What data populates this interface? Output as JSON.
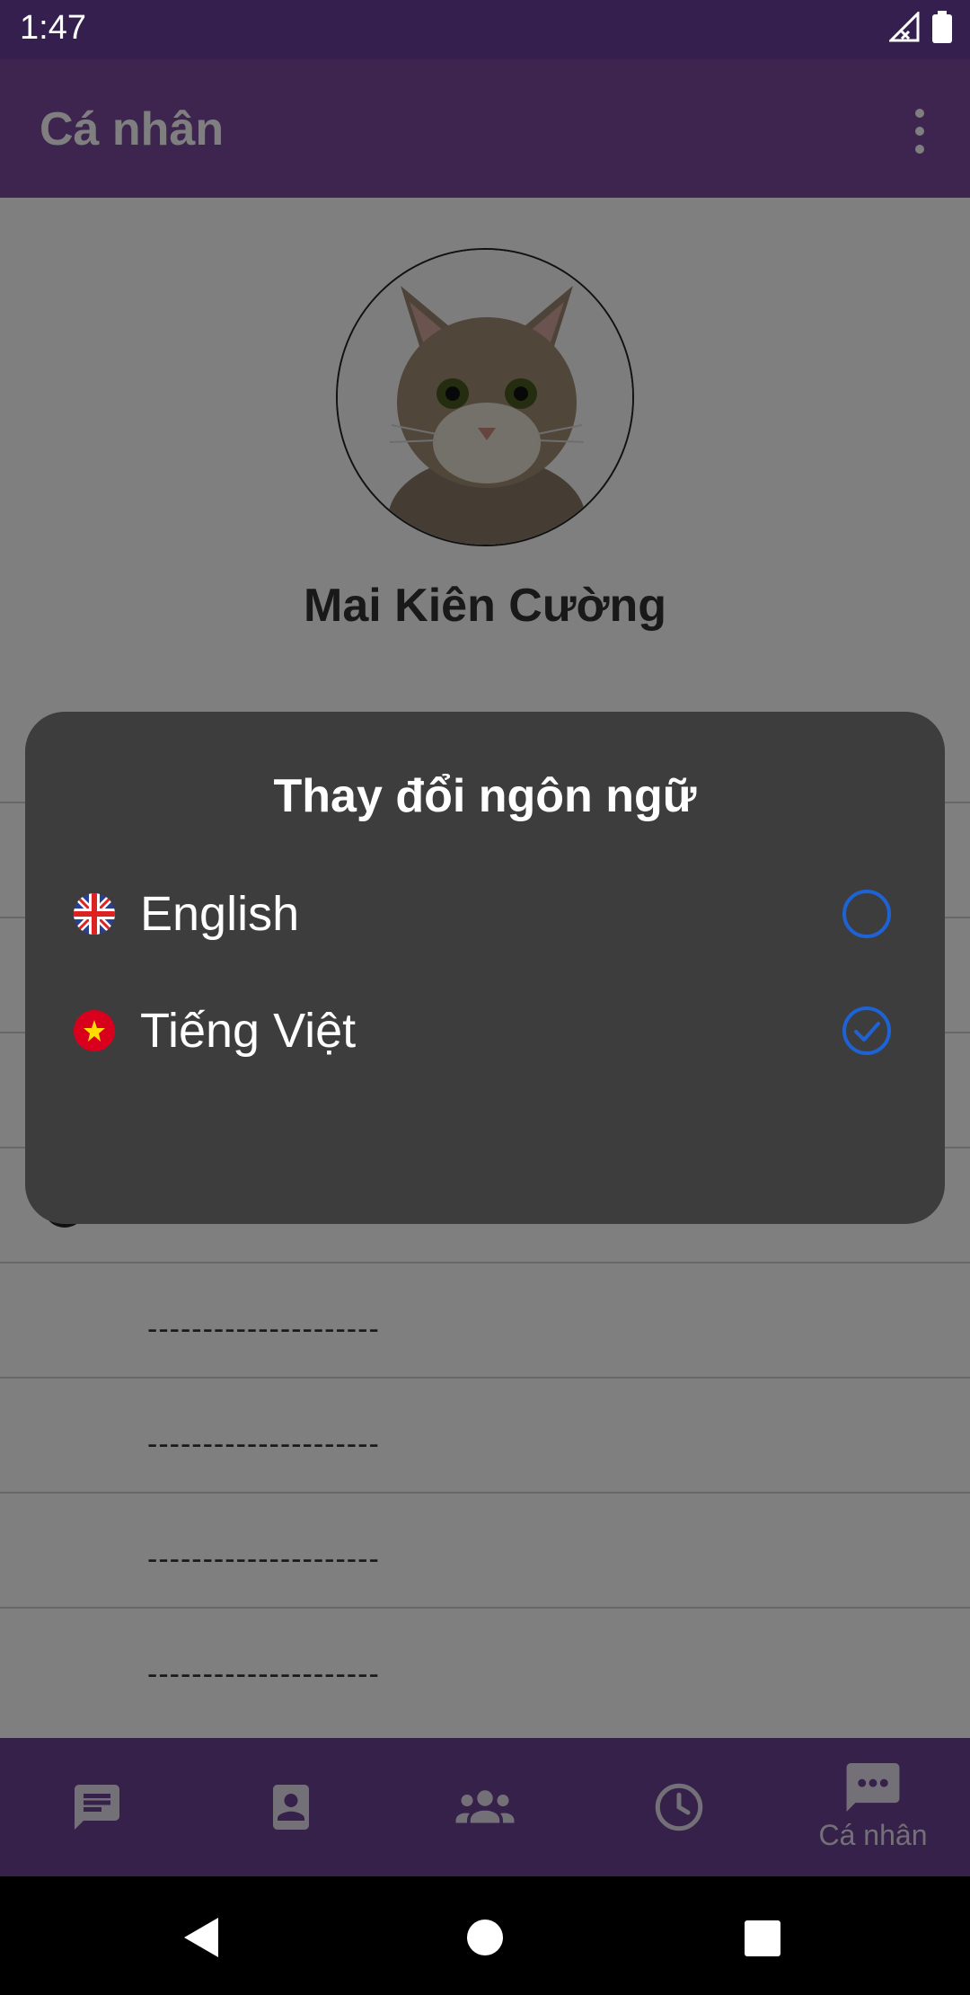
{
  "status_bar": {
    "time": "1:47"
  },
  "app_bar": {
    "title": "Cá nhân"
  },
  "profile": {
    "name": "Mai Kiên Cường"
  },
  "menu_rows": [
    {
      "label": ""
    },
    {
      "label": ""
    },
    {
      "label": ""
    },
    {
      "label": ""
    },
    {
      "label": "---------------------"
    },
    {
      "label": "---------------------"
    },
    {
      "label": "---------------------"
    },
    {
      "label": "---------------------"
    }
  ],
  "dialog": {
    "title": "Thay đổi ngôn ngữ",
    "options": [
      {
        "label": "English",
        "flag": "uk-flag-icon",
        "selected": false
      },
      {
        "label": "Tiếng Việt",
        "flag": "vietnam-flag-icon",
        "selected": true
      }
    ]
  },
  "bottom_nav": {
    "items": [
      {
        "icon": "chat-icon",
        "label": ""
      },
      {
        "icon": "contact-icon",
        "label": ""
      },
      {
        "icon": "group-icon",
        "label": ""
      },
      {
        "icon": "clock-icon",
        "label": ""
      },
      {
        "icon": "more-chat-icon",
        "label": "Cá nhân"
      }
    ]
  },
  "colors": {
    "accent": "#7b4b9e",
    "nav_bg": "#6a4292",
    "dialog_bg": "#3d3d3d",
    "radio_blue": "#1e63d6"
  }
}
